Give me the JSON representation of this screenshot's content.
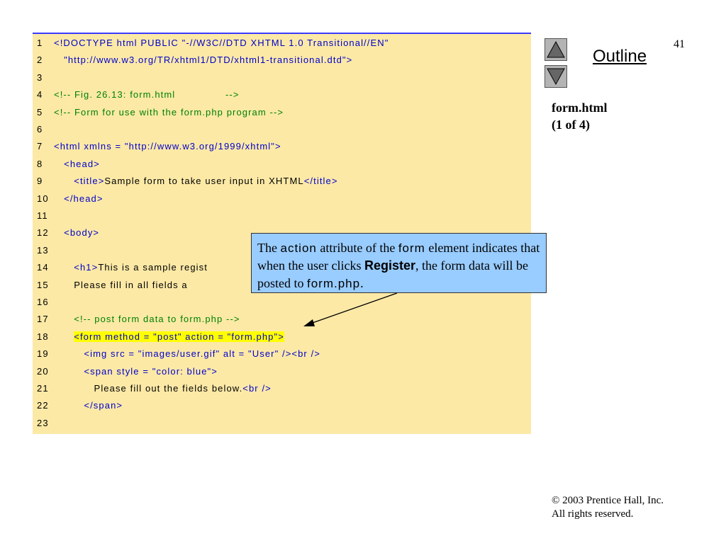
{
  "page_number": "41",
  "outline_label": "Outline",
  "file_label_1": "form.html",
  "file_label_2": "(1 of 4)",
  "copyright_line_1": "© 2003 Prentice Hall, Inc.",
  "copyright_line_2": "All rights reserved.",
  "callout": {
    "t1": "The ",
    "t2": "action",
    "t3": " attribute of the ",
    "t4": "form",
    "t5": " element indicates that when the user clicks ",
    "t6": "Register",
    "t7": ", the form data will be posted to ",
    "t8": "form.php",
    "t9": "."
  },
  "code_lines": [
    {
      "n": "1",
      "segs": [
        {
          "t": "<!DOCTYPE html PUBLIC \"-//W3C//DTD XHTML 1.0 Transitional//EN\"",
          "c": "b"
        }
      ]
    },
    {
      "n": "2",
      "segs": [
        {
          "t": "   \"http://www.w3.org/TR/xhtml1/DTD/xhtml1-transitional.dtd\">",
          "c": "b"
        }
      ]
    },
    {
      "n": "3",
      "segs": []
    },
    {
      "n": "4",
      "segs": [
        {
          "t": "<!-- Fig. 26.13: form.html               -->",
          "c": "g"
        }
      ]
    },
    {
      "n": "5",
      "segs": [
        {
          "t": "<!-- Form for use with the form.php program -->",
          "c": "g"
        }
      ]
    },
    {
      "n": "6",
      "segs": []
    },
    {
      "n": "7",
      "segs": [
        {
          "t": "<html xmlns = \"http://www.w3.org/1999/xhtml\">",
          "c": "b"
        }
      ]
    },
    {
      "n": "8",
      "segs": [
        {
          "t": "   <head>",
          "c": "b"
        }
      ]
    },
    {
      "n": "9",
      "segs": [
        {
          "t": "      <title>",
          "c": "b"
        },
        {
          "t": "Sample form to take user input in XHTML",
          "c": "k"
        },
        {
          "t": "</title>",
          "c": "b"
        }
      ]
    },
    {
      "n": "10",
      "segs": [
        {
          "t": "   </head>",
          "c": "b"
        }
      ]
    },
    {
      "n": "11",
      "segs": []
    },
    {
      "n": "12",
      "segs": [
        {
          "t": "   <body>",
          "c": "b"
        }
      ]
    },
    {
      "n": "13",
      "segs": []
    },
    {
      "n": "14",
      "segs": [
        {
          "t": "      <h1>",
          "c": "b"
        },
        {
          "t": "This is a sample regist",
          "c": "k"
        }
      ]
    },
    {
      "n": "15",
      "segs": [
        {
          "t": "      Please fill in all fields a",
          "c": "k"
        }
      ]
    },
    {
      "n": "16",
      "segs": []
    },
    {
      "n": "17",
      "segs": [
        {
          "t": "      <!-- post form data to form.php -->",
          "c": "g"
        }
      ]
    },
    {
      "n": "18",
      "segs": [
        {
          "t": "      ",
          "c": "k"
        },
        {
          "t": "<form method = \"post\" action = \"form.php\">",
          "c": "b",
          "hl": true
        }
      ]
    },
    {
      "n": "19",
      "segs": [
        {
          "t": "         <img src = \"images/user.gif\" alt = \"User\" /><br />",
          "c": "b"
        }
      ]
    },
    {
      "n": "20",
      "segs": [
        {
          "t": "         <span style = \"color: blue\">",
          "c": "b"
        }
      ]
    },
    {
      "n": "21",
      "segs": [
        {
          "t": "            Please fill out the fields below.",
          "c": "k"
        },
        {
          "t": "<br />",
          "c": "b"
        }
      ]
    },
    {
      "n": "22",
      "segs": [
        {
          "t": "         </span>",
          "c": "b"
        }
      ]
    },
    {
      "n": "23",
      "segs": []
    }
  ]
}
